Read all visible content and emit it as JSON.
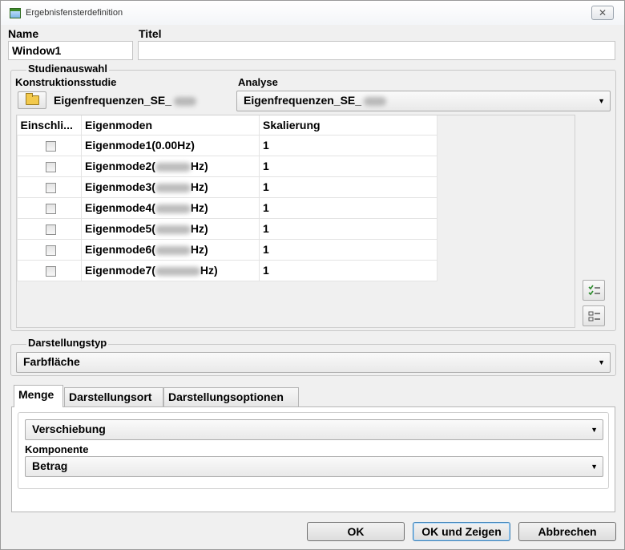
{
  "window": {
    "title": "Ergebnisfensterdefinition",
    "close_glyph": "✕"
  },
  "name_label": "Name",
  "title_label": "Titel",
  "name_value": "Window1",
  "title_value": "",
  "study": {
    "group_label": "Studienauswahl",
    "design_study_label": "Konstruktionsstudie",
    "design_study_value": "Eigenfrequenzen_SE_",
    "analysis_label": "Analyse",
    "analysis_value": "Eigenfrequenzen_SE_"
  },
  "table": {
    "headers": [
      "Einschli...",
      "Eigenmoden",
      "Skalierung"
    ],
    "rows": [
      {
        "mode_prefix": "Eigenmode1(0.00Hz)",
        "mode_suffix": "",
        "blurred": false,
        "scale": "1",
        "checked": false
      },
      {
        "mode_prefix": "Eigenmode2(",
        "mode_suffix": "Hz)",
        "blurred": true,
        "scale": "1",
        "checked": false
      },
      {
        "mode_prefix": "Eigenmode3(",
        "mode_suffix": "Hz)",
        "blurred": true,
        "scale": "1",
        "checked": false
      },
      {
        "mode_prefix": "Eigenmode4(",
        "mode_suffix": "Hz)",
        "blurred": true,
        "scale": "1",
        "checked": false
      },
      {
        "mode_prefix": "Eigenmode5(",
        "mode_suffix": "Hz)",
        "blurred": true,
        "scale": "1",
        "checked": false
      },
      {
        "mode_prefix": "Eigenmode6(",
        "mode_suffix": "Hz)",
        "blurred": true,
        "scale": "1",
        "checked": false
      },
      {
        "mode_prefix": "Eigenmode7(",
        "mode_suffix": "Hz)",
        "blurred": true,
        "scale": "1",
        "checked": false
      }
    ]
  },
  "display_type": {
    "group_label": "Darstellungstyp",
    "value": "Farbfläche"
  },
  "tabs": [
    {
      "label": "Menge",
      "active": true
    },
    {
      "label": "Darstellungsort",
      "active": false
    },
    {
      "label": "Darstellungsoptionen",
      "active": false
    }
  ],
  "quantity": {
    "value": "Verschiebung",
    "component_label": "Komponente",
    "component_value": "Betrag"
  },
  "buttons": {
    "ok": "OK",
    "ok_show": "OK und Zeigen",
    "cancel": "Abbrechen"
  },
  "colors": {
    "background": "#f0f0f0",
    "accent": "#3c7fb1"
  }
}
